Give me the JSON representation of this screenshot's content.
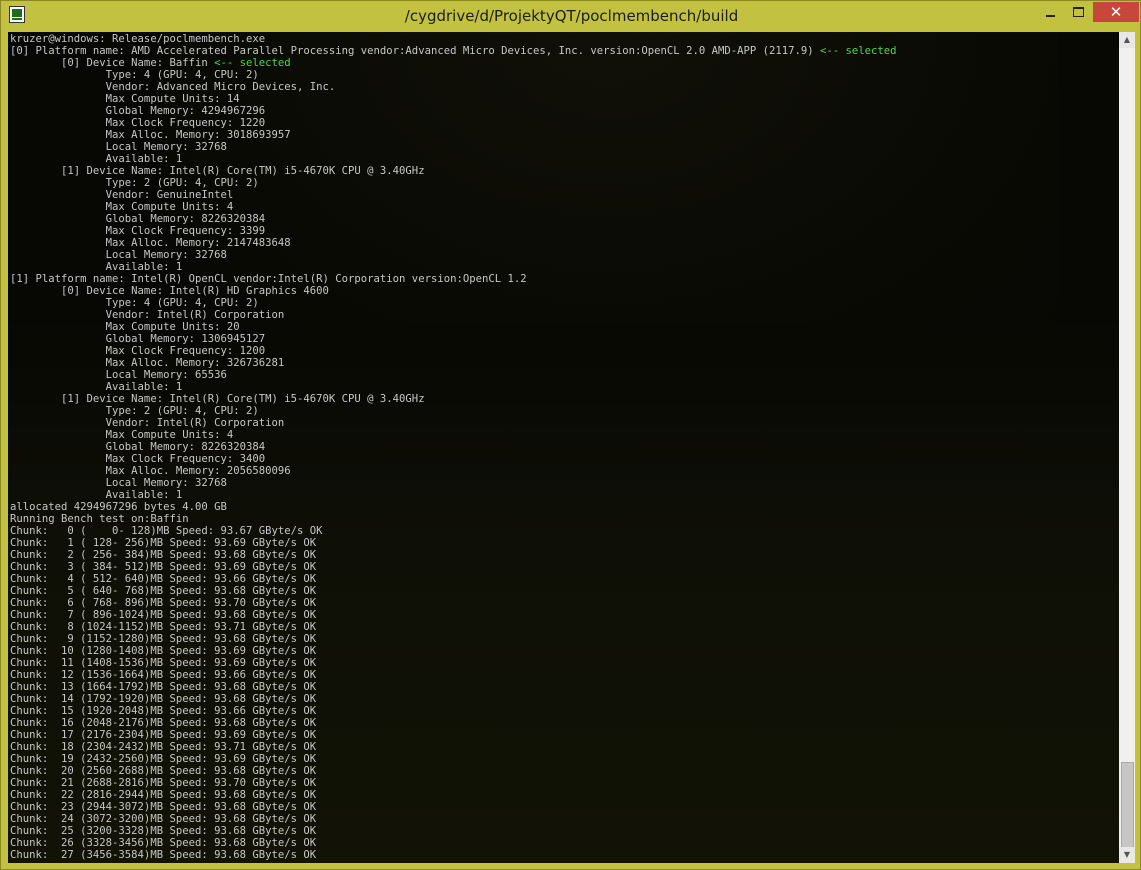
{
  "window": {
    "title": "/cygdrive/d/ProjektyQT/poclmembench/build",
    "minimize_icon": "minimize-icon",
    "maximize_icon": "maximize-icon",
    "close_icon": "close-icon",
    "app_icon": "terminal-app-icon"
  },
  "terminal": {
    "lines": [
      [
        {
          "t": "kruzer@windows: Release/poclmembench.exe"
        }
      ],
      [
        {
          "t": "[0] Platform name: AMD Accelerated Parallel Processing vendor:Advanced Micro Devices, Inc. version:OpenCL 2.0 AMD-APP (2117.9) "
        },
        {
          "t": "<-- selected",
          "c": "sel"
        }
      ],
      [
        {
          "t": "        [0] Device Name: Baffin "
        },
        {
          "t": "<-- selected",
          "c": "sel"
        }
      ],
      [
        {
          "t": "               Type: 4 (GPU: 4, CPU: 2)"
        }
      ],
      [
        {
          "t": "               Vendor: Advanced Micro Devices, Inc."
        }
      ],
      [
        {
          "t": "               Max Compute Units: 14"
        }
      ],
      [
        {
          "t": "               Global Memory: 4294967296"
        }
      ],
      [
        {
          "t": "               Max Clock Frequency: 1220"
        }
      ],
      [
        {
          "t": "               Max Alloc. Memory: 3018693957"
        }
      ],
      [
        {
          "t": "               Local Memory: 32768"
        }
      ],
      [
        {
          "t": "               Available: 1"
        }
      ],
      [
        {
          "t": "        [1] Device Name: Intel(R) Core(TM) i5-4670K CPU @ 3.40GHz"
        }
      ],
      [
        {
          "t": "               Type: 2 (GPU: 4, CPU: 2)"
        }
      ],
      [
        {
          "t": "               Vendor: GenuineIntel"
        }
      ],
      [
        {
          "t": "               Max Compute Units: 4"
        }
      ],
      [
        {
          "t": "               Global Memory: 8226320384"
        }
      ],
      [
        {
          "t": "               Max Clock Frequency: 3399"
        }
      ],
      [
        {
          "t": "               Max Alloc. Memory: 2147483648"
        }
      ],
      [
        {
          "t": "               Local Memory: 32768"
        }
      ],
      [
        {
          "t": "               Available: 1"
        }
      ],
      [
        {
          "t": "[1] Platform name: Intel(R) OpenCL vendor:Intel(R) Corporation version:OpenCL 1.2"
        }
      ],
      [
        {
          "t": "        [0] Device Name: Intel(R) HD Graphics 4600"
        }
      ],
      [
        {
          "t": "               Type: 4 (GPU: 4, CPU: 2)"
        }
      ],
      [
        {
          "t": "               Vendor: Intel(R) Corporation"
        }
      ],
      [
        {
          "t": "               Max Compute Units: 20"
        }
      ],
      [
        {
          "t": "               Global Memory: 1306945127"
        }
      ],
      [
        {
          "t": "               Max Clock Frequency: 1200"
        }
      ],
      [
        {
          "t": "               Max Alloc. Memory: 326736281"
        }
      ],
      [
        {
          "t": "               Local Memory: 65536"
        }
      ],
      [
        {
          "t": "               Available: 1"
        }
      ],
      [
        {
          "t": "        [1] Device Name: Intel(R) Core(TM) i5-4670K CPU @ 3.40GHz"
        }
      ],
      [
        {
          "t": "               Type: 2 (GPU: 4, CPU: 2)"
        }
      ],
      [
        {
          "t": "               Vendor: Intel(R) Corporation"
        }
      ],
      [
        {
          "t": "               Max Compute Units: 4"
        }
      ],
      [
        {
          "t": "               Global Memory: 8226320384"
        }
      ],
      [
        {
          "t": "               Max Clock Frequency: 3400"
        }
      ],
      [
        {
          "t": "               Max Alloc. Memory: 2056580096"
        }
      ],
      [
        {
          "t": "               Local Memory: 32768"
        }
      ],
      [
        {
          "t": "               Available: 1"
        }
      ],
      [
        {
          "t": "allocated 4294967296 bytes 4.00 GB"
        }
      ],
      [
        {
          "t": "Running Bench test on:Baffin"
        }
      ],
      [
        {
          "t": "Chunk:   0 (    0- 128)MB Speed: 93.67 GByte/s OK"
        }
      ],
      [
        {
          "t": "Chunk:   1 ( 128- 256)MB Speed: 93.69 GByte/s OK"
        }
      ],
      [
        {
          "t": "Chunk:   2 ( 256- 384)MB Speed: 93.68 GByte/s OK"
        }
      ],
      [
        {
          "t": "Chunk:   3 ( 384- 512)MB Speed: 93.69 GByte/s OK"
        }
      ],
      [
        {
          "t": "Chunk:   4 ( 512- 640)MB Speed: 93.66 GByte/s OK"
        }
      ],
      [
        {
          "t": "Chunk:   5 ( 640- 768)MB Speed: 93.68 GByte/s OK"
        }
      ],
      [
        {
          "t": "Chunk:   6 ( 768- 896)MB Speed: 93.70 GByte/s OK"
        }
      ],
      [
        {
          "t": "Chunk:   7 ( 896-1024)MB Speed: 93.68 GByte/s OK"
        }
      ],
      [
        {
          "t": "Chunk:   8 (1024-1152)MB Speed: 93.71 GByte/s OK"
        }
      ],
      [
        {
          "t": "Chunk:   9 (1152-1280)MB Speed: 93.68 GByte/s OK"
        }
      ],
      [
        {
          "t": "Chunk:  10 (1280-1408)MB Speed: 93.69 GByte/s OK"
        }
      ],
      [
        {
          "t": "Chunk:  11 (1408-1536)MB Speed: 93.69 GByte/s OK"
        }
      ],
      [
        {
          "t": "Chunk:  12 (1536-1664)MB Speed: 93.66 GByte/s OK"
        }
      ],
      [
        {
          "t": "Chunk:  13 (1664-1792)MB Speed: 93.68 GByte/s OK"
        }
      ],
      [
        {
          "t": "Chunk:  14 (1792-1920)MB Speed: 93.68 GByte/s OK"
        }
      ],
      [
        {
          "t": "Chunk:  15 (1920-2048)MB Speed: 93.66 GByte/s OK"
        }
      ],
      [
        {
          "t": "Chunk:  16 (2048-2176)MB Speed: 93.68 GByte/s OK"
        }
      ],
      [
        {
          "t": "Chunk:  17 (2176-2304)MB Speed: 93.69 GByte/s OK"
        }
      ],
      [
        {
          "t": "Chunk:  18 (2304-2432)MB Speed: 93.71 GByte/s OK"
        }
      ],
      [
        {
          "t": "Chunk:  19 (2432-2560)MB Speed: 93.69 GByte/s OK"
        }
      ],
      [
        {
          "t": "Chunk:  20 (2560-2688)MB Speed: 93.68 GByte/s OK"
        }
      ],
      [
        {
          "t": "Chunk:  21 (2688-2816)MB Speed: 93.70 GByte/s OK"
        }
      ],
      [
        {
          "t": "Chunk:  22 (2816-2944)MB Speed: 93.68 GByte/s OK"
        }
      ],
      [
        {
          "t": "Chunk:  23 (2944-3072)MB Speed: 93.68 GByte/s OK"
        }
      ],
      [
        {
          "t": "Chunk:  24 (3072-3200)MB Speed: 93.68 GByte/s OK"
        }
      ],
      [
        {
          "t": "Chunk:  25 (3200-3328)MB Speed: 93.68 GByte/s OK"
        }
      ],
      [
        {
          "t": "Chunk:  26 (3328-3456)MB Speed: 93.68 GByte/s OK"
        }
      ],
      [
        {
          "t": "Chunk:  27 (3456-3584)MB Speed: 93.68 GByte/s OK"
        }
      ]
    ]
  },
  "scrollbar": {
    "up_icon": "scroll-up-arrow-icon",
    "down_icon": "scroll-down-arrow-icon"
  },
  "colors": {
    "frame": "#c2c240",
    "terminal_bg": "#070703",
    "text": "#c6c6c6",
    "selected": "#4fd64f",
    "close_button": "#c7473a"
  }
}
